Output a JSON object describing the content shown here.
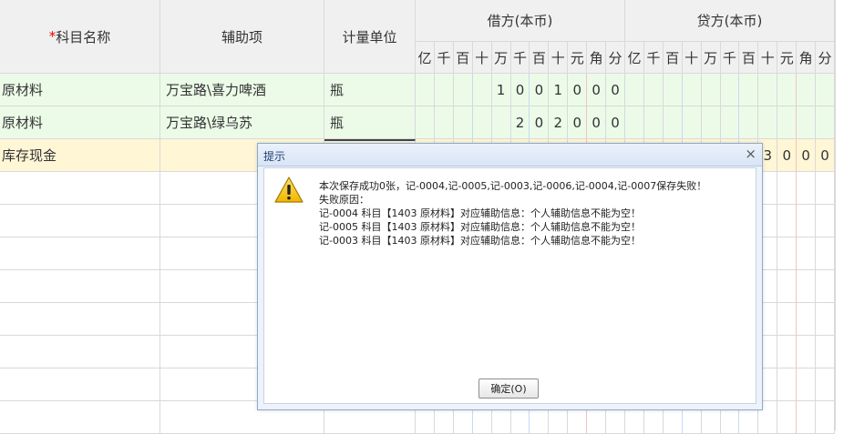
{
  "headers": {
    "required_mark": "*",
    "subject": "科目名称",
    "aux": "辅助项",
    "unit": "计量单位",
    "debit": "借方(本币)",
    "credit": "贷方(本币)",
    "digit_units": [
      "亿",
      "千",
      "百",
      "十",
      "万",
      "千",
      "百",
      "十",
      "元",
      "角",
      "分"
    ]
  },
  "rows": [
    {
      "subject": "原材料",
      "aux": "万宝路\\喜力啤酒",
      "unit": "瓶",
      "debit_digits": [
        "",
        "",
        "",
        "",
        "1",
        "0",
        "0",
        "1",
        "0",
        "0",
        "0"
      ],
      "credit_digits": [
        "",
        "",
        "",
        "",
        "",
        "",
        "",
        "",
        "",
        "",
        ""
      ]
    },
    {
      "subject": "原材料",
      "aux": "万宝路\\绿乌苏",
      "unit": "瓶",
      "debit_digits": [
        "",
        "",
        "",
        "",
        "",
        "2",
        "0",
        "2",
        "0",
        "0",
        "0"
      ],
      "credit_digits": [
        "",
        "",
        "",
        "",
        "",
        "",
        "",
        "",
        "",
        "",
        ""
      ]
    },
    {
      "subject": "库存现金",
      "aux": "",
      "unit": "",
      "debit_digits": [
        "",
        "",
        "",
        "",
        "",
        "",
        "",
        "",
        "",
        "",
        ""
      ],
      "credit_digits": [
        "",
        "",
        "",
        "",
        "",
        "",
        "",
        "3",
        "0",
        "0",
        "0"
      ]
    }
  ],
  "dialog": {
    "title": "提示",
    "close": "×",
    "lines": [
      "本次保存成功0张，记-0004,记-0005,记-0003,记-0006,记-0004,记-0007保存失败！",
      "失败原因：",
      "记-0004 科目【1403 原材料】对应辅助信息：个人辅助信息不能为空！",
      "记-0005 科目【1403 原材料】对应辅助信息：个人辅助信息不能为空！",
      "记-0003 科目【1403 原材料】对应辅助信息：个人辅助信息不能为空！"
    ],
    "ok_label": "确定(O)",
    "icon": "warning-icon"
  }
}
